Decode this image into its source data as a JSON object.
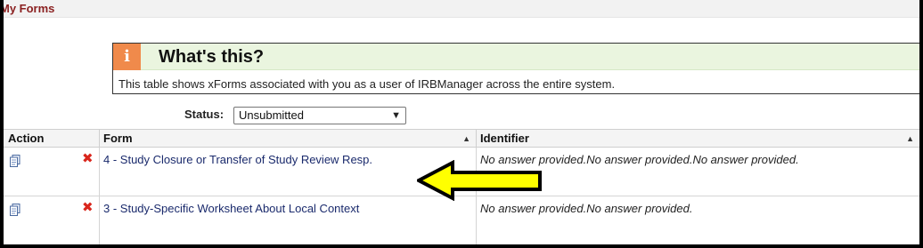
{
  "page": {
    "title": "My Forms"
  },
  "info": {
    "icon": "info-icon",
    "heading": "What's this?",
    "body": "This table shows xForms associated with you as a user of IRBManager across the entire system."
  },
  "filter": {
    "label": "Status:",
    "selected": "Unsubmitted"
  },
  "table": {
    "headers": {
      "action": "Action",
      "form": "Form",
      "identifier": "Identifier"
    },
    "rows": [
      {
        "form": "4 - Study Closure or Transfer of Study Review Resp.",
        "identifier": "No answer provided.No answer provided.No answer provided."
      },
      {
        "form": "3 - Study-Specific Worksheet About Local Context",
        "identifier": "No answer provided.No answer provided."
      }
    ]
  },
  "colors": {
    "info_accent": "#f08a4b",
    "info_header_bg": "#eaf5df",
    "delete_red": "#d9261c",
    "link_blue": "#1a2a6c",
    "annotation_arrow": "#ffff00"
  },
  "annotation": {
    "type": "arrow",
    "direction": "left",
    "target": "row-1-form-link"
  }
}
